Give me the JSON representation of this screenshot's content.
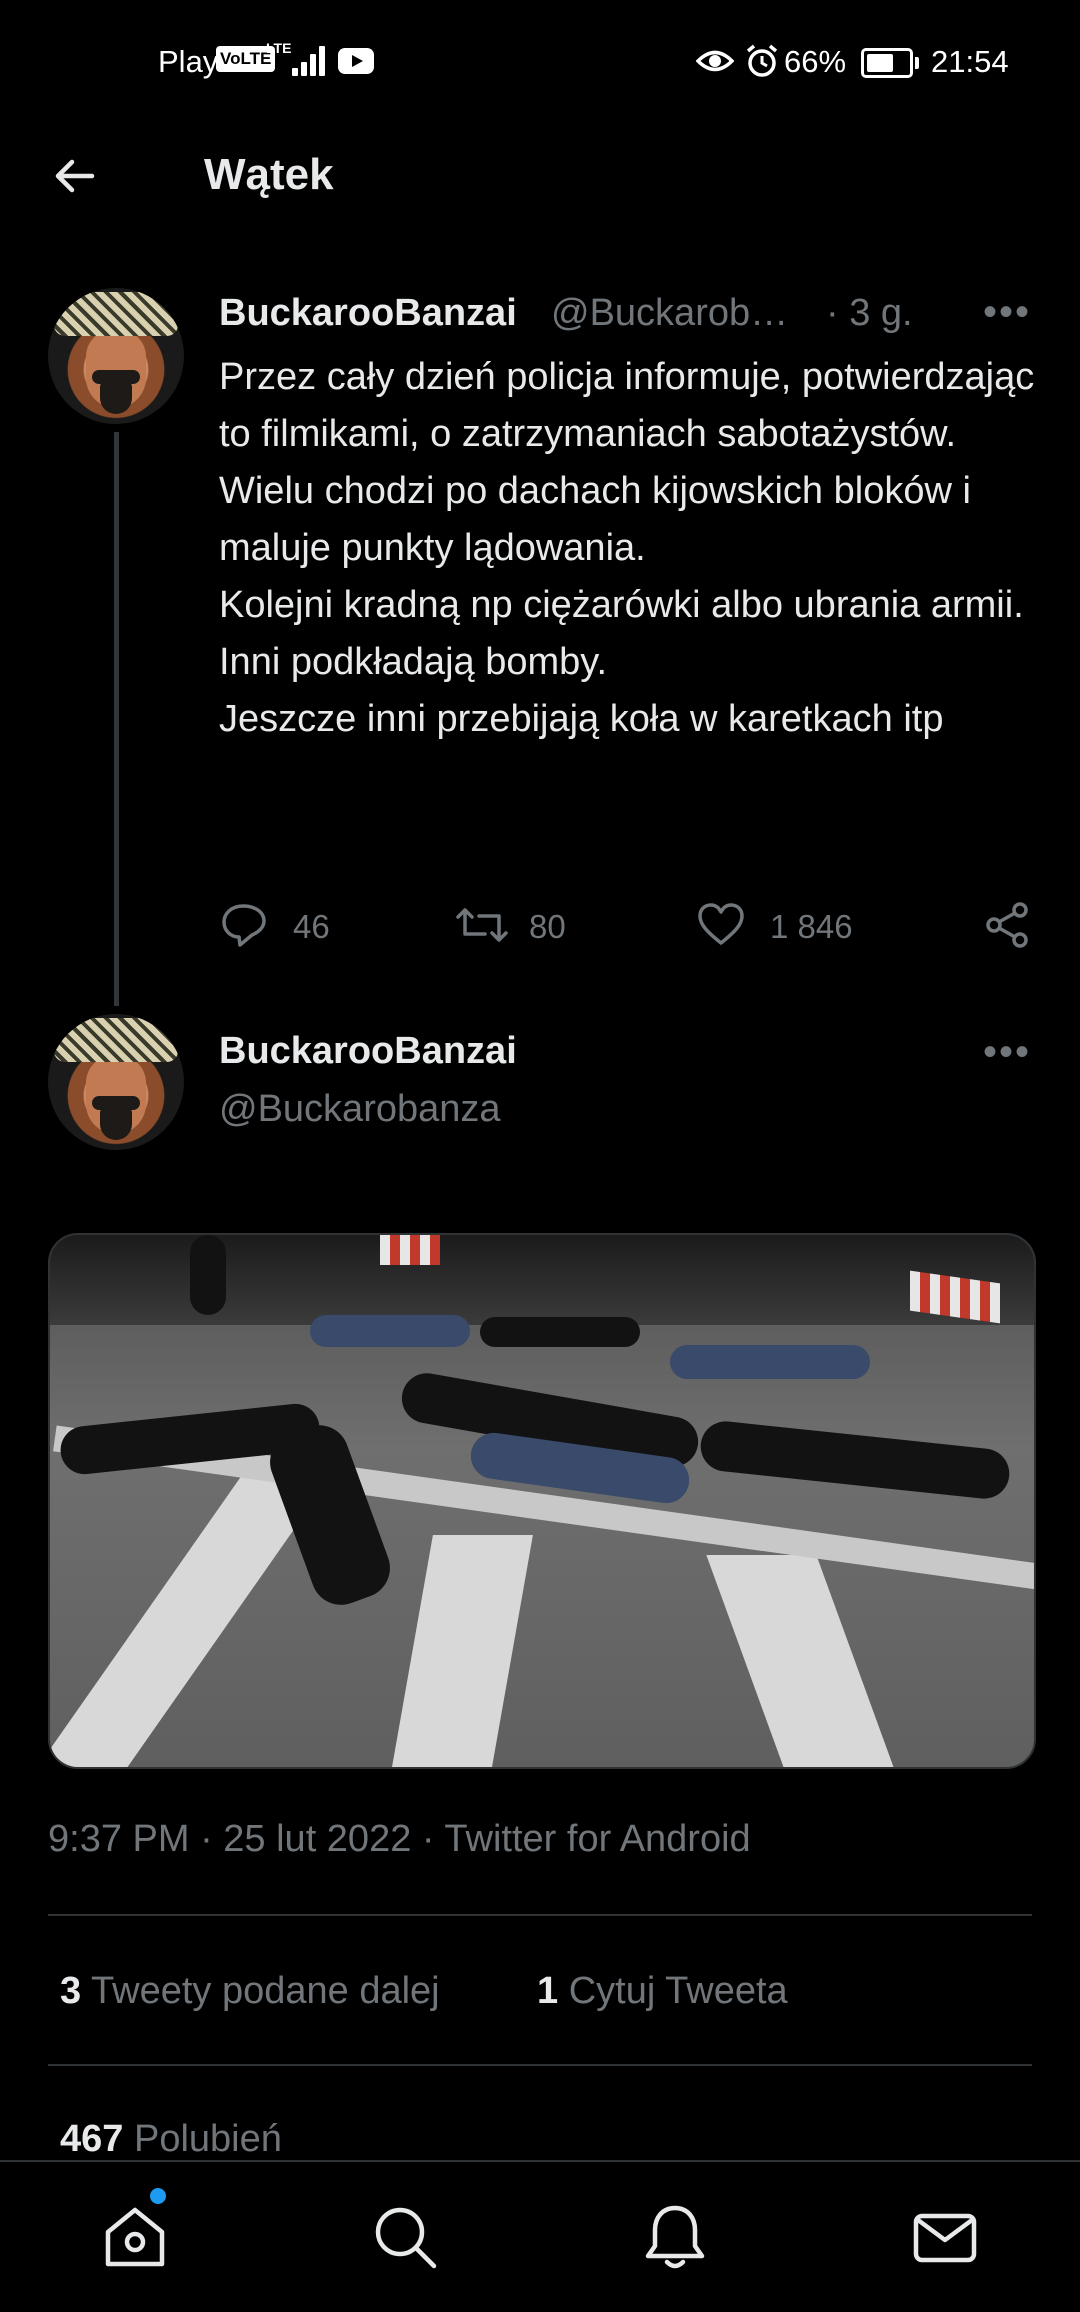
{
  "status_bar": {
    "carrier": "Play",
    "volte": "VoLTE",
    "lte": "LTE",
    "battery_percent": "66%",
    "battery_level": 0.66,
    "time": "21:54"
  },
  "header": {
    "title": "Wątek",
    "back_icon": "arrow-left-icon"
  },
  "tweet_parent": {
    "display_name": "BuckarooBanzai",
    "handle": "@Buckarob…",
    "age": "· 3 g.",
    "text": "Przez cały dzień policja informuje, potwierdzając to filmikami, o zatrzymaniach sabotażystów.\nWielu chodzi po dachach kijowskich bloków i maluje punkty lądowania.\nKolejni kradną np ciężarówki albo ubrania armii.\nInni podkładają bomby.\nJeszcze inni przebijają koła w karetkach itp",
    "replies": "46",
    "retweets": "80",
    "likes": "1 846"
  },
  "tweet_main": {
    "display_name": "BuckarooBanzai",
    "handle": "@Buckarobanza",
    "timestamp": "9:37 PM · 25 lut 2022 · Twitter for Android",
    "retweets_count": "3",
    "retweets_label": "Tweety podane dalej",
    "quotes_count": "1",
    "quotes_label": "Cytuj Tweeta",
    "likes_count": "467",
    "likes_label": "Polubień"
  },
  "bottom_nav": {
    "items": [
      "home-icon",
      "search-icon",
      "bell-icon",
      "mail-icon"
    ],
    "home_has_notification": true
  },
  "colors": {
    "background": "#000000",
    "text_primary": "#e7e9ea",
    "text_secondary": "#71767b",
    "accent": "#1d9bf0",
    "divider": "#2f3336"
  }
}
